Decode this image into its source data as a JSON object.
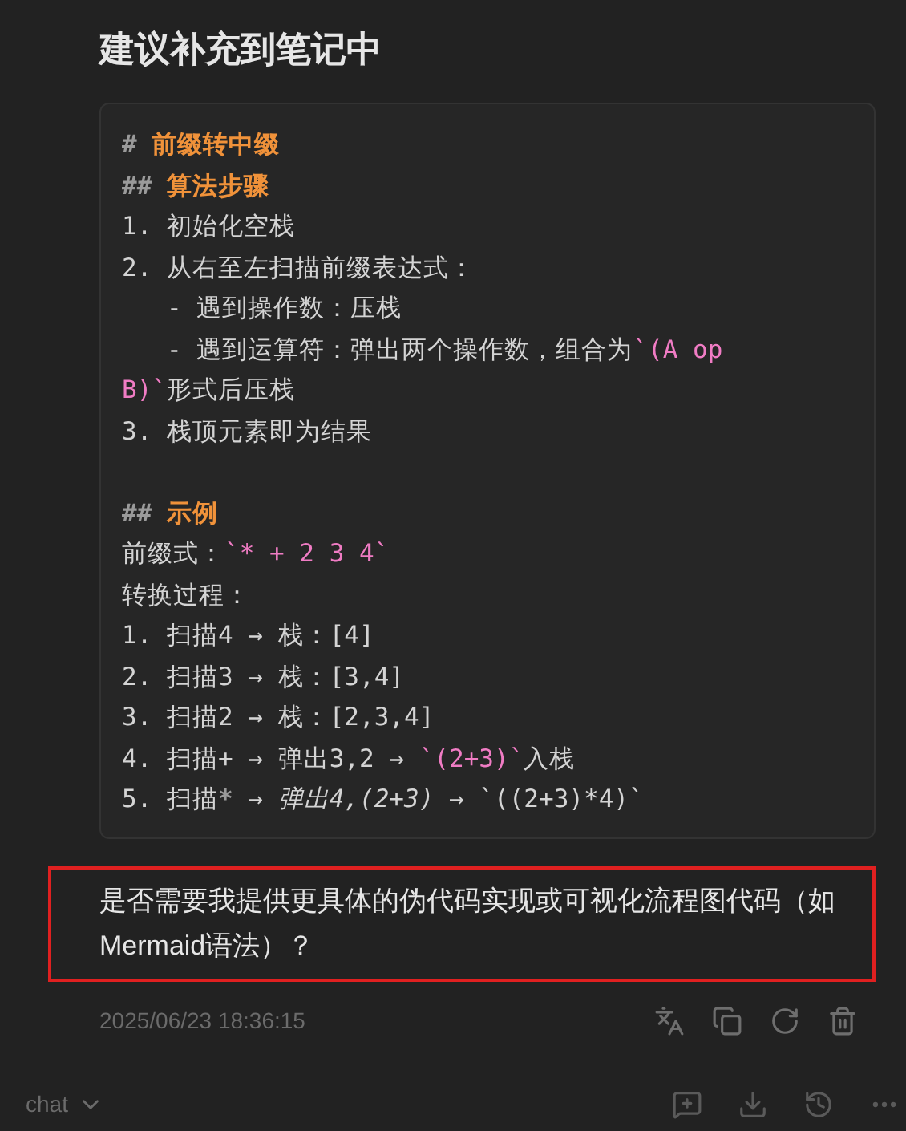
{
  "title": "建议补充到笔记中",
  "code_sections": [
    [
      [
        {
          "kind": "marker",
          "text": "# "
        },
        {
          "kind": "heading",
          "text": "前缀转中缀"
        }
      ],
      [
        {
          "kind": "marker",
          "text": "## "
        },
        {
          "kind": "heading",
          "text": "算法步骤"
        }
      ],
      [
        {
          "kind": "text",
          "text": "1. 初始化空栈"
        }
      ],
      [
        {
          "kind": "text",
          "text": "2. 从右至左扫描前缀表达式："
        }
      ],
      [
        {
          "kind": "text",
          "text": "   - 遇到操作数：压栈"
        }
      ],
      [
        {
          "kind": "text",
          "text": "   - 遇到运算符：弹出两个操作数，组合为"
        },
        {
          "kind": "code",
          "text": "`(A op"
        }
      ],
      [
        {
          "kind": "code",
          "text": "B)`"
        },
        {
          "kind": "text",
          "text": "形式后压栈"
        }
      ],
      [
        {
          "kind": "text",
          "text": "3. 栈顶元素即为结果"
        }
      ]
    ],
    [
      [
        {
          "kind": "marker",
          "text": "## "
        },
        {
          "kind": "heading",
          "text": "示例"
        }
      ],
      [
        {
          "kind": "text",
          "text": "前缀式："
        },
        {
          "kind": "code",
          "text": "`* + 2 3 4`"
        }
      ],
      [
        {
          "kind": "text",
          "text": "转换过程："
        }
      ],
      [
        {
          "kind": "text",
          "text": "1. 扫描4 → 栈：[4]"
        }
      ],
      [
        {
          "kind": "text",
          "text": "2. 扫描3 → 栈：[3,4]"
        }
      ],
      [
        {
          "kind": "text",
          "text": "3. 扫描2 → 栈：[2,3,4]"
        }
      ],
      [
        {
          "kind": "text",
          "text": "4. 扫描+ → 弹出3,2 → "
        },
        {
          "kind": "code",
          "text": "`(2+3)`"
        },
        {
          "kind": "text",
          "text": "入栈"
        }
      ],
      [
        {
          "kind": "text",
          "text": "5. 扫描"
        },
        {
          "kind": "marker",
          "text": "*"
        },
        {
          "kind": "text",
          "text": " → "
        },
        {
          "kind": "italic",
          "text": "弹出4,(2+3)"
        },
        {
          "kind": "text",
          "text": " → `((2+3)*4)`"
        }
      ]
    ]
  ],
  "question": "是否需要我提供更具体的伪代码实现或可视化流程图代码（如Mermaid语法）？",
  "timestamp": "2025/06/23 18:36:15",
  "mode": "chat"
}
